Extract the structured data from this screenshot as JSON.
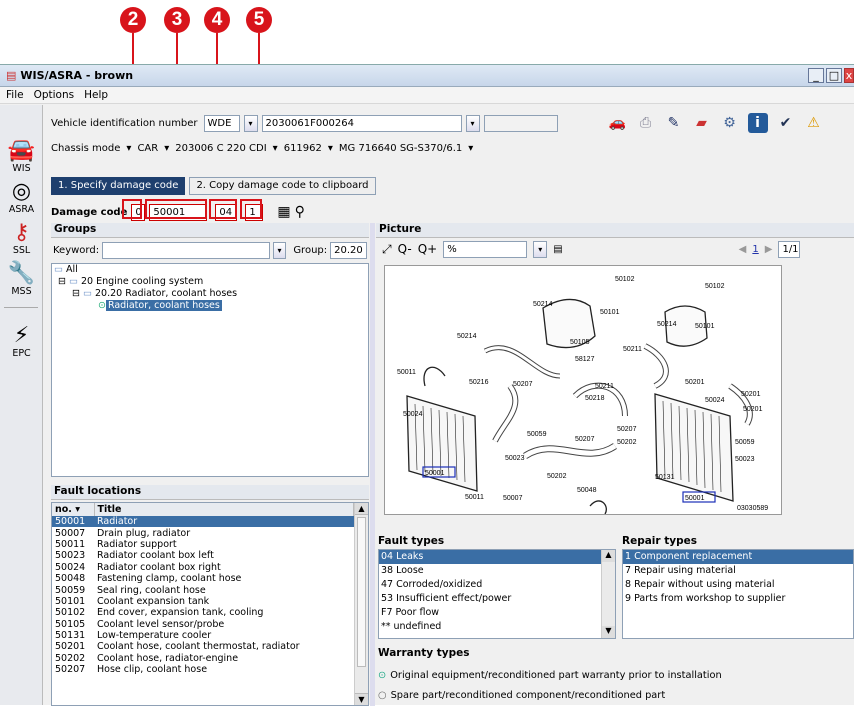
{
  "callouts": [
    "2",
    "3",
    "4",
    "5"
  ],
  "window": {
    "title": "WIS/ASRA - brown"
  },
  "menu": [
    "File",
    "Options",
    "Help"
  ],
  "nav": [
    {
      "label": "WIS",
      "icon": "car-icon"
    },
    {
      "label": "ASRA",
      "icon": "gauge-icon"
    },
    {
      "label": "SSL",
      "icon": "key-icon"
    },
    {
      "label": "MSS",
      "icon": "wrench-icon"
    },
    {
      "label": "EPC",
      "icon": "spark-plug-icon"
    }
  ],
  "vin": {
    "label": "Vehicle identification number",
    "prefix": "WDE",
    "number": "2030061F000264"
  },
  "chassis": {
    "label": "Chassis mode",
    "crumbs": [
      "CAR",
      "203006 C 220 CDI",
      "611962",
      "MG 716640 SG-S370/6.1"
    ]
  },
  "tabs": [
    "1. Specify damage code",
    "2. Copy damage code to clipboard"
  ],
  "damage": {
    "label": "Damage code",
    "parts": [
      "0",
      "50001",
      "04",
      "1"
    ]
  },
  "groups": {
    "title": "Groups",
    "keyword_label": "Keyword:",
    "keyword_value": "",
    "group_label": "Group:",
    "group_value": "20.20",
    "tree": [
      "All",
      "20  Engine cooling system",
      "20.20  Radiator, coolant hoses",
      "Radiator, coolant hoses"
    ]
  },
  "fault_locations": {
    "title": "Fault locations",
    "headers": [
      "no.",
      "Title"
    ],
    "rows": [
      [
        "50001",
        "Radiator"
      ],
      [
        "50007",
        "Drain plug, radiator"
      ],
      [
        "50011",
        "Radiator support"
      ],
      [
        "50023",
        "Radiator coolant box left"
      ],
      [
        "50024",
        "Radiator coolant box right"
      ],
      [
        "50048",
        "Fastening clamp, coolant hose"
      ],
      [
        "50059",
        "Seal ring, coolant hose"
      ],
      [
        "50101",
        "Coolant expansion tank"
      ],
      [
        "50102",
        "End cover, expansion tank, cooling"
      ],
      [
        "50105",
        "Coolant level sensor/probe"
      ],
      [
        "50131",
        "Low-temperature cooler"
      ],
      [
        "50201",
        "Coolant hose, coolant thermostat, radiator"
      ],
      [
        "50202",
        "Coolant hose, radiator-engine"
      ],
      [
        "50207",
        "Hose clip, coolant hose"
      ]
    ]
  },
  "picture": {
    "title": "Picture",
    "zoom": "%",
    "page": "1",
    "page_total": "1/1",
    "labels": [
      "50102",
      "50102",
      "50214",
      "50101",
      "50214",
      "50101",
      "50214",
      "50105",
      "58127",
      "50211",
      "50011",
      "50216",
      "50207",
      "50211",
      "50201",
      "50218",
      "50024",
      "50201",
      "50024",
      "50059",
      "50201",
      "50207",
      "50207",
      "50059",
      "50023",
      "50023",
      "50202",
      "50202",
      "50001",
      "50048",
      "50131",
      "50011",
      "50007",
      "50001",
      "03030589"
    ]
  },
  "fault_types": {
    "title": "Fault types",
    "items": [
      "04  Leaks",
      "38  Loose",
      "47  Corroded/oxidized",
      "53  Insufficient effect/power",
      "F7  Poor flow",
      "**  undefined"
    ]
  },
  "repair_types": {
    "title": "Repair types",
    "items": [
      "1  Component replacement",
      "7  Repair using material",
      "8  Repair without using material",
      "9  Parts from workshop to supplier"
    ]
  },
  "warranty": {
    "title": "Warranty types",
    "options": [
      "Original equipment/reconditioned part warranty prior to installation",
      "Spare part/reconditioned component/reconditioned part"
    ]
  }
}
